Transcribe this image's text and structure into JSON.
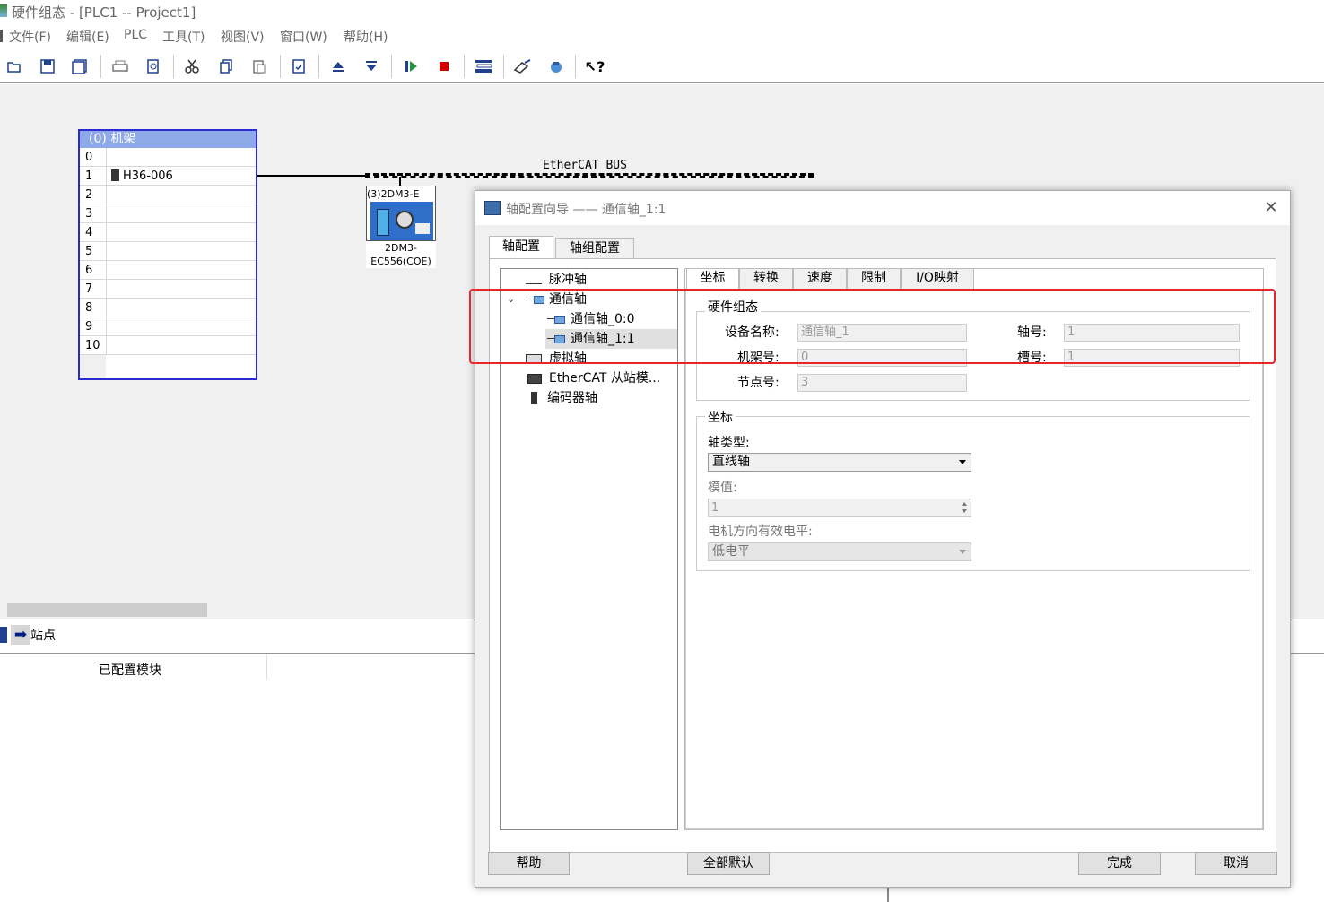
{
  "window": {
    "title": "硬件组态 - [PLC1 -- Project1]"
  },
  "menu": [
    "文件(F)",
    "编辑(E)",
    "PLC",
    "工具(T)",
    "视图(V)",
    "窗口(W)",
    "帮助(H)"
  ],
  "toolbar": {
    "icons": [
      "open-icon",
      "save-icon",
      "save-all-icon",
      "print-icon",
      "print-preview-icon",
      "cut-icon",
      "copy-icon",
      "paste-icon",
      "document-icon",
      "upload-icon",
      "download-icon",
      "run-icon",
      "stop-icon",
      "network-icon",
      "diagnose-icon",
      "online-icon",
      "help-icon"
    ],
    "help_glyph": "?"
  },
  "rack": {
    "header": "(0)   机架",
    "rows": [
      {
        "num": "0",
        "module": ""
      },
      {
        "num": "1",
        "module": "H36-006"
      },
      {
        "num": "2",
        "module": ""
      },
      {
        "num": "3",
        "module": ""
      },
      {
        "num": "4",
        "module": ""
      },
      {
        "num": "5",
        "module": ""
      },
      {
        "num": "6",
        "module": ""
      },
      {
        "num": "7",
        "module": ""
      },
      {
        "num": "8",
        "module": ""
      },
      {
        "num": "9",
        "module": ""
      },
      {
        "num": "10",
        "module": ""
      }
    ]
  },
  "bus": {
    "label": "EtherCAT BUS"
  },
  "slave": {
    "header": "(3)2DM3-E",
    "label_line1": "2DM3-",
    "label_line2": "EC556(COE)"
  },
  "bottom": {
    "station_label": "站点",
    "column_header": "已配置模块"
  },
  "dialog": {
    "title": "轴配置向导 —— 通信轴_1:1",
    "close_glyph": "✕",
    "tabs": [
      "轴配置",
      "轴组配置"
    ],
    "tree": {
      "pulse_axis": "脉冲轴",
      "comm_axis": "通信轴",
      "comm_axis_0": "通信轴_0:0",
      "comm_axis_1": "通信轴_1:1",
      "virtual_axis": "虚拟轴",
      "ethercat_slave": "EtherCAT 从站模...",
      "encoder_axis": "编码器轴"
    },
    "inner_tabs": [
      "坐标",
      "转换",
      "速度",
      "限制",
      "I/O映射"
    ],
    "hardware_group": {
      "title": "硬件组态",
      "device_name_label": "设备名称:",
      "device_name_value": "通信轴_1",
      "axis_no_label": "轴号:",
      "axis_no_value": "1",
      "rack_no_label": "机架号:",
      "rack_no_value": "0",
      "slot_no_label": "槽号:",
      "slot_no_value": "1",
      "node_no_label": "节点号:",
      "node_no_value": "3"
    },
    "coord_group": {
      "title": "坐标",
      "axis_type_label": "轴类型:",
      "axis_type_value": "直线轴",
      "modulo_label": "模值:",
      "modulo_value": "1",
      "motor_dir_label": "电机方向有效电平:",
      "motor_dir_value": "低电平"
    },
    "buttons": {
      "help": "帮助",
      "all_default": "全部默认",
      "finish": "完成",
      "cancel": "取消"
    }
  },
  "colors": {
    "highlight_box": "#e8262a",
    "rack_header": "#8ea9e8",
    "rack_border": "#2a2ad0"
  }
}
